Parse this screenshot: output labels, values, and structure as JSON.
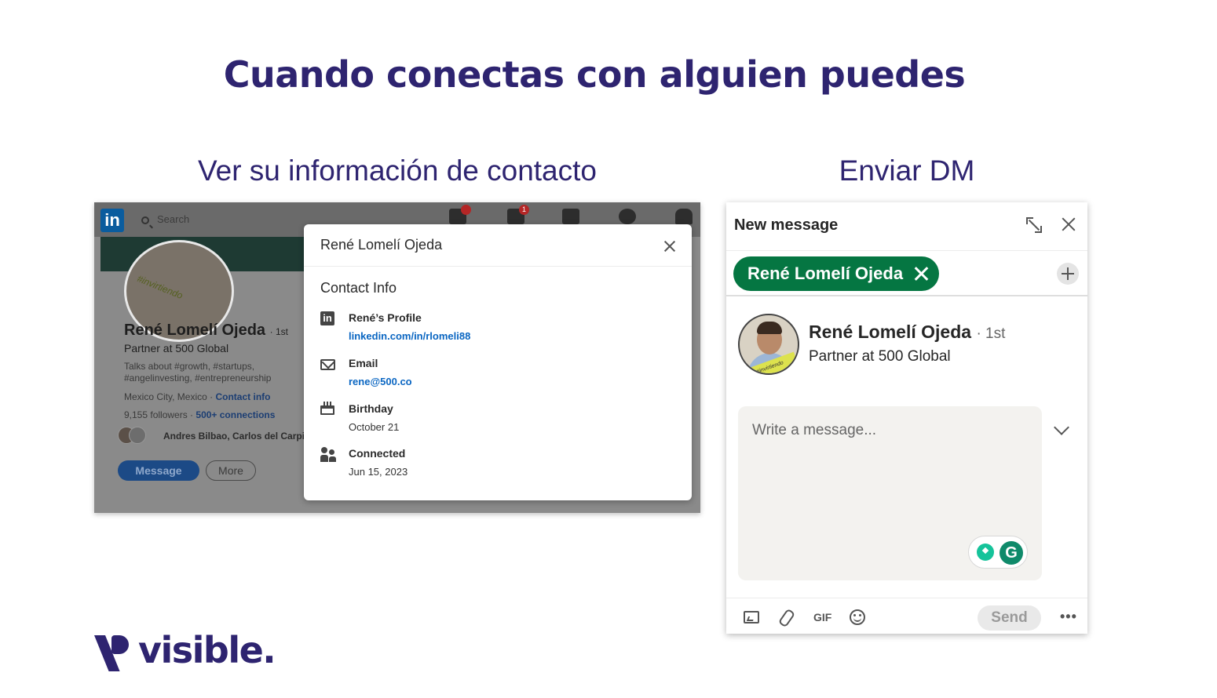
{
  "slide": {
    "title": "Cuando conectas con alguien puedes",
    "left_subtitle": "Ver su información de contacto",
    "right_subtitle": "Enviar DM",
    "brand_name": "visible."
  },
  "linkedin_profile_bg": {
    "logo": "in",
    "search_placeholder": "Search",
    "badges": {
      "home": "",
      "network": "1"
    },
    "name": "René Lomelí Ojeda",
    "degree": "· 1st",
    "headline": "Partner at 500 Global",
    "about": "Talks about #growth, #startups, #angelinvesting, #entrepreneurship",
    "location": "Mexico City, Mexico ·",
    "contact_info_link": "Contact info",
    "followers": "9,155 followers ·",
    "connections_link": "500+ connections",
    "mutuals": "Andres Bilbao, Carlos del Carpio",
    "avatar_ring_text": "#invirtiendo",
    "message_button": "Message",
    "more_button": "More"
  },
  "contact_modal": {
    "title": "René Lomelí Ojeda",
    "section_heading": "Contact Info",
    "rows": [
      {
        "icon": "linkedin-icon",
        "label": "René’s Profile",
        "value": "linkedin.com/in/rlomeli88",
        "is_link": true
      },
      {
        "icon": "mail-icon",
        "label": "Email",
        "value": "rene@500.co",
        "is_link": true
      },
      {
        "icon": "calendar-icon",
        "label": "Birthday",
        "value": "October 21",
        "is_link": false
      },
      {
        "icon": "people-icon",
        "label": "Connected",
        "value": "Jun 15, 2023",
        "is_link": false
      }
    ]
  },
  "dm": {
    "header_title": "New message",
    "recipient_chip": "René Lomelí Ojeda",
    "recipient_name": "René Lomelí Ojeda",
    "recipient_degree": "· 1st",
    "recipient_headline": "Partner at 500 Global",
    "avatar_ring_text": "#invirtiendo",
    "message_placeholder": "Write a message...",
    "grammarly_letter": "G",
    "gif_label": "GIF",
    "send_button": "Send",
    "more_label": "•••"
  },
  "colors": {
    "brand": "#2e2470",
    "linkedin_green": "#057642",
    "link_blue": "#0a66c2"
  }
}
